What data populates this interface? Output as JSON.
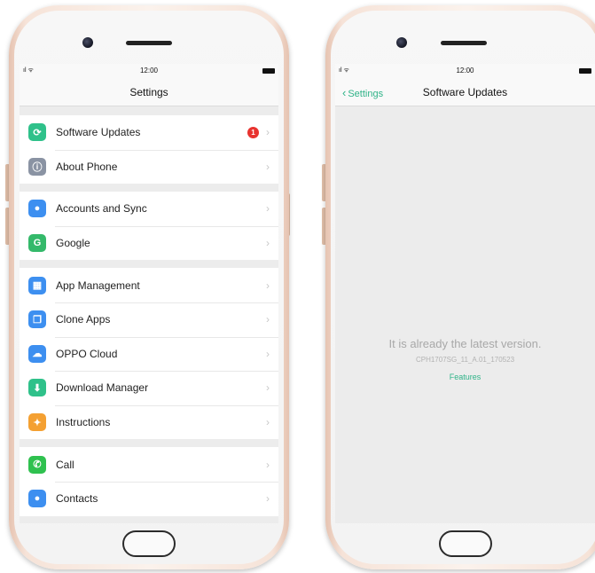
{
  "left_phone": {
    "status": {
      "time": "12:00",
      "signal": "ıl ᯤ"
    },
    "nav_title": "Settings",
    "groups": [
      [
        {
          "label": "Software Updates",
          "icon": "refresh-icon",
          "icon_glyph": "⟳",
          "color": "#2fc18a",
          "badge": "1"
        },
        {
          "label": "About Phone",
          "icon": "info-icon",
          "icon_glyph": "ⓘ",
          "color": "#8a93a3"
        }
      ],
      [
        {
          "label": "Accounts and Sync",
          "icon": "account-icon",
          "icon_glyph": "●",
          "color": "#3d8ff0"
        },
        {
          "label": "Google",
          "icon": "google-icon",
          "icon_glyph": "G",
          "color": "#34b96a"
        }
      ],
      [
        {
          "label": "App Management",
          "icon": "grid-icon",
          "icon_glyph": "▦",
          "color": "#3d8ff0"
        },
        {
          "label": "Clone Apps",
          "icon": "clone-icon",
          "icon_glyph": "❐",
          "color": "#3d8ff0"
        },
        {
          "label": "OPPO Cloud",
          "icon": "cloud-icon",
          "icon_glyph": "☁",
          "color": "#3d8ff0"
        },
        {
          "label": "Download Manager",
          "icon": "download-icon",
          "icon_glyph": "⬇",
          "color": "#2fc18a"
        },
        {
          "label": "Instructions",
          "icon": "bulb-icon",
          "icon_glyph": "✦",
          "color": "#f4a032"
        }
      ],
      [
        {
          "label": "Call",
          "icon": "phone-icon",
          "icon_glyph": "✆",
          "color": "#2fc14f"
        },
        {
          "label": "Contacts",
          "icon": "contact-icon",
          "icon_glyph": "●",
          "color": "#3d8ff0"
        }
      ]
    ]
  },
  "right_phone": {
    "status": {
      "time": "12:00",
      "signal": "ıl ᯤ"
    },
    "back_label": "Settings",
    "nav_title": "Software Updates",
    "message": "It is already the latest version.",
    "version": "CPH1707SG_11_A.01_170523",
    "features_link": "Features"
  },
  "colors": {
    "accent": "#2fb388",
    "badge": "#e8332f",
    "gold": "#e6c3b1"
  }
}
